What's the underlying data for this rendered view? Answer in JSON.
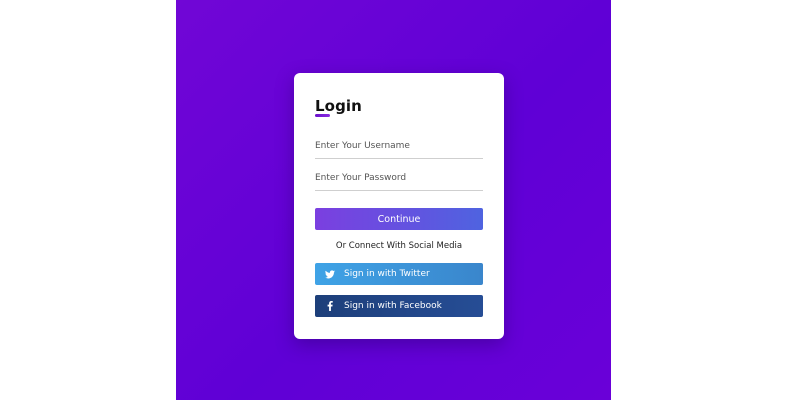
{
  "login": {
    "title": "Login",
    "username_placeholder": "Enter Your Username",
    "password_placeholder": "Enter Your Password",
    "continue_label": "Continue",
    "social_divider": "Or Connect With Social Media",
    "twitter_label": "Sign in with Twitter",
    "facebook_label": "Sign in with Facebook"
  },
  "icons": {
    "twitter": "twitter-icon",
    "facebook": "facebook-icon"
  },
  "colors": {
    "background": "#6400d6",
    "continue_start": "#7b3fe0",
    "continue_end": "#4f63e0",
    "twitter": "#3fa3e6",
    "facebook": "#1d3f7a"
  }
}
